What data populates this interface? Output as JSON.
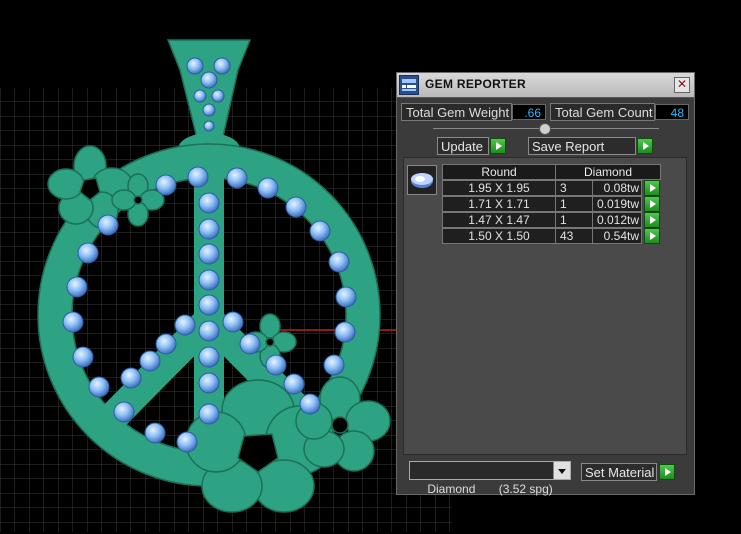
{
  "panel": {
    "title": "GEM REPORTER",
    "close_glyph": "✕",
    "total_weight_label": "Total Gem Weight",
    "total_weight_value": ".66",
    "total_count_label": "Total Gem Count",
    "total_count_value": "48",
    "update_label": "Update",
    "save_report_label": "Save Report",
    "table": {
      "shape_header": "Round",
      "material_header": "Diamond",
      "rows": [
        {
          "size": "1.95 X 1.95",
          "qty": "3",
          "weight": "0.08tw"
        },
        {
          "size": "1.71 X 1.71",
          "qty": "1",
          "weight": "0.019tw"
        },
        {
          "size": "1.47 X 1.47",
          "qty": "1",
          "weight": "0.012tw"
        },
        {
          "size": "1.50 X 1.50",
          "qty": "43",
          "weight": "0.54tw"
        }
      ]
    },
    "material_select_value": "Diamond       (3.52 spg)",
    "set_material_label": "Set Material"
  },
  "colors": {
    "metal": "#2ea383",
    "metal_edge": "#1c6f58",
    "gem": "#7eb3f3",
    "grid": "#3a3a3a",
    "axis": "#c02020",
    "value_text": "#2fb6ff"
  },
  "icons": {
    "app": "gem-reporter-icon",
    "gem_shape": "round-gem-icon",
    "go": "play-arrow-icon"
  }
}
